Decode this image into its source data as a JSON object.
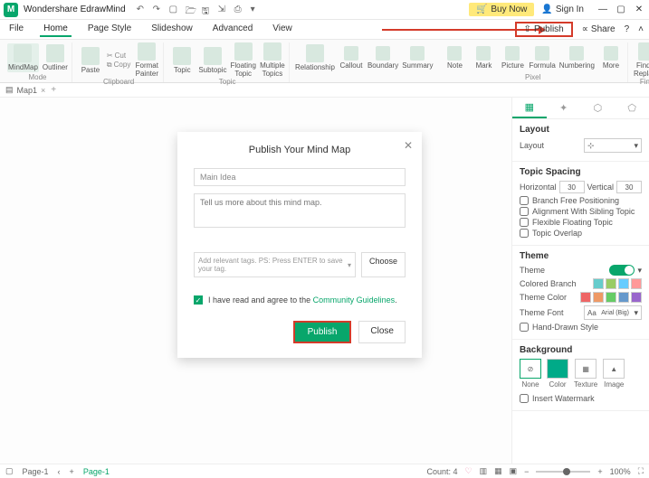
{
  "title": {
    "app": "Wondershare EdrawMind"
  },
  "topright": {
    "buy": "Buy Now",
    "signin": "Sign In"
  },
  "menu": {
    "file": "File",
    "home": "Home",
    "page_style": "Page Style",
    "slideshow": "Slideshow",
    "advanced": "Advanced",
    "view": "View"
  },
  "share_row": {
    "publish": "Publish",
    "share": "Share"
  },
  "ribbon": {
    "mindmap": "MindMap",
    "outliner": "Outliner",
    "paste": "Paste",
    "cut": "Cut",
    "copy": "Copy",
    "format_painter": "Format\nPainter",
    "topic": "Topic",
    "subtopic": "Subtopic",
    "floating_topic": "Floating\nTopic",
    "multiple_topics": "Multiple\nTopics",
    "relationship": "Relationship",
    "callout": "Callout",
    "boundary": "Boundary",
    "summary": "Summary",
    "note": "Note",
    "mark": "Mark",
    "picture": "Picture",
    "formula": "Formula",
    "numbering": "Numbering",
    "more": "More",
    "find_replace": "Find &\nReplace",
    "grp_mode": "Mode",
    "grp_clipboard": "Clipboard",
    "grp_topic": "Topic",
    "grp_pixel": "Pixel",
    "grp_find": "Find"
  },
  "doc": {
    "tab1": "Map1"
  },
  "panel": {
    "layout_hdr": "Layout",
    "layout_lbl": "Layout",
    "spacing_hdr": "Topic Spacing",
    "horizontal": "Horizontal",
    "vertical": "Vertical",
    "h_val": "30",
    "v_val": "30",
    "branch_free": "Branch Free Positioning",
    "align_sibling": "Alignment With Sibling Topic",
    "flex_float": "Flexible Floating Topic",
    "topic_overlap": "Topic Overlap",
    "theme_hdr": "Theme",
    "theme_lbl": "Theme",
    "colored_branch": "Colored Branch",
    "theme_color": "Theme Color",
    "theme_font": "Theme Font",
    "font_val": "Arial (Big)",
    "hand_drawn": "Hand-Drawn Style",
    "bg_hdr": "Background",
    "bg_none": "None",
    "bg_color": "Color",
    "bg_texture": "Texture",
    "bg_image": "Image",
    "watermark": "Insert Watermark"
  },
  "dialog": {
    "title": "Publish Your Mind Map",
    "main_idea": "Main Idea",
    "desc_ph": "Tell us more about this mind map.",
    "tags_ph": "Add relevant tags. PS: Press ENTER to save your tag.",
    "choose": "Choose",
    "agree_pre": "I have read and agree to the ",
    "agree_link": "Community Guidelines",
    "publish": "Publish",
    "close": "Close"
  },
  "status": {
    "page": "Page-1",
    "page_sel": "Page-1",
    "count": "Count: 4",
    "zoom": "100%"
  }
}
